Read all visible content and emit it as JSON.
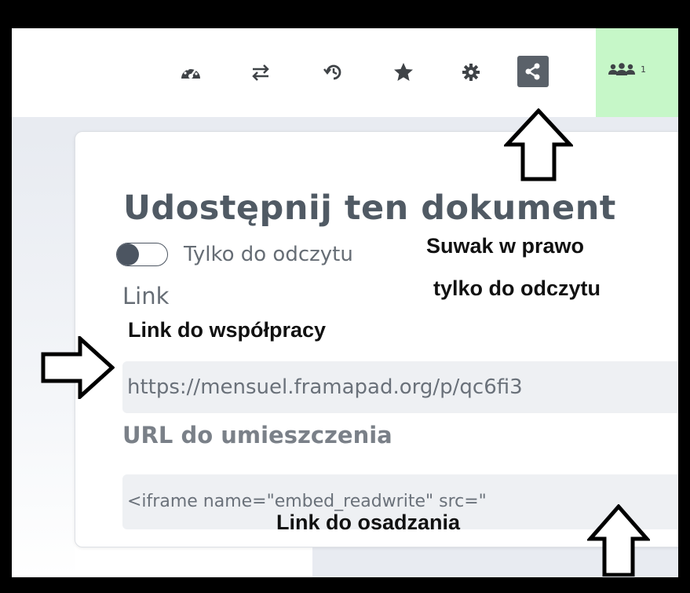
{
  "toolbar": {
    "icons": [
      "dashboard-icon",
      "swap-icon",
      "history-icon",
      "star-icon",
      "gear-icon",
      "share-icon"
    ],
    "users_count": "1"
  },
  "share_dialog": {
    "title": "Udostępnij ten dokument",
    "readonly_label": "Tylko do odczytu",
    "readonly_on": false,
    "link_label": "Link",
    "link_value": "https://mensuel.framapad.org/p/qc6fi3",
    "embed_label": "URL do umieszczenia",
    "embed_value": "<iframe name=\"embed_readwrite\" src=\""
  },
  "annotations": {
    "slider_line1": "Suwak w prawo",
    "slider_line2": "tylko do odczytu",
    "link_note": "Link do współpracy",
    "embed_note": "Link do osadzania"
  },
  "colors": {
    "share_button": "#5a6169",
    "users_panel": "#c6f7c8",
    "title": "#505a64"
  }
}
